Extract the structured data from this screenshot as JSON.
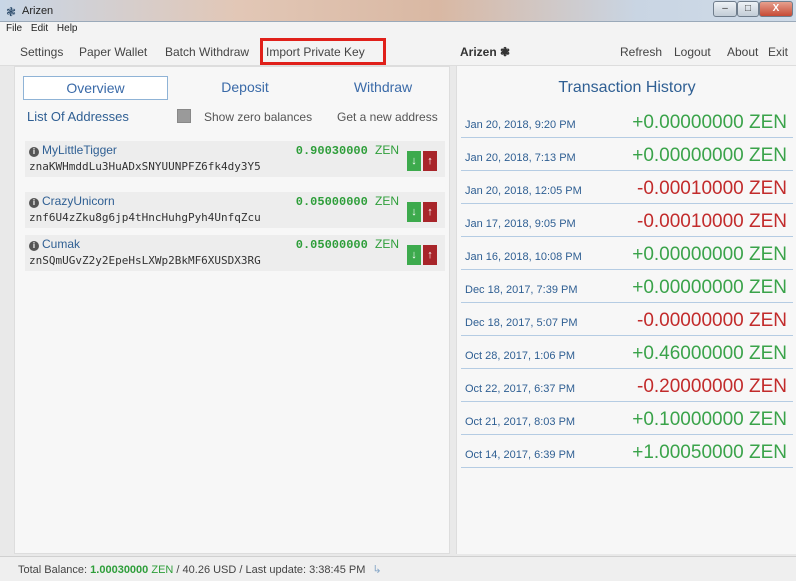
{
  "window": {
    "title": "Arizen",
    "icon": "arizen-logo-icon",
    "minimize": "–",
    "maximize": "□",
    "close": "X"
  },
  "menu": [
    "File",
    "Edit",
    "Help"
  ],
  "nav": {
    "settings": "Settings",
    "paper_wallet": "Paper Wallet",
    "batch_withdraw": "Batch Withdraw",
    "import_private_key": "Import Private Key",
    "brand": "Arizen ❃",
    "refresh": "Refresh",
    "logout": "Logout",
    "about": "About",
    "exit": "Exit"
  },
  "tabs": {
    "overview": "Overview",
    "deposit": "Deposit",
    "withdraw": "Withdraw"
  },
  "addresses_section": {
    "title": "List Of Addresses",
    "show_zero_label": "Show zero balances",
    "get_new_label": "Get a new address",
    "items": [
      {
        "name": "MyLittleTigger",
        "balance": "0.90030000",
        "unit": "ZEN",
        "address": "znaKWHmddLu3HuADxSNYUUNPFZ6fk4dy3Y5"
      },
      {
        "name": "CrazyUnicorn",
        "balance": "0.05000000",
        "unit": "ZEN",
        "address": "znf6U4zZku8g6jp4tHncHuhgPyh4UnfqZcu"
      },
      {
        "name": "Cumak",
        "balance": "0.05000000",
        "unit": "ZEN",
        "address": "znSQmUGvZ2y2EpeHsLXWp2BkMF6XUSDX3RG"
      }
    ]
  },
  "history": {
    "title": "Transaction History",
    "items": [
      {
        "date": "Jan 20, 2018, 9:20 PM",
        "amount": "+0.00000000 ZEN",
        "sign": "pos"
      },
      {
        "date": "Jan 20, 2018, 7:13 PM",
        "amount": "+0.00000000 ZEN",
        "sign": "pos"
      },
      {
        "date": "Jan 20, 2018, 12:05 PM",
        "amount": "-0.00010000 ZEN",
        "sign": "neg"
      },
      {
        "date": "Jan 17, 2018, 9:05 PM",
        "amount": "-0.00010000 ZEN",
        "sign": "neg"
      },
      {
        "date": "Jan 16, 2018, 10:08 PM",
        "amount": "+0.00000000 ZEN",
        "sign": "pos"
      },
      {
        "date": "Dec 18, 2017, 7:39 PM",
        "amount": "+0.00000000 ZEN",
        "sign": "pos"
      },
      {
        "date": "Dec 18, 2017, 5:07 PM",
        "amount": "-0.00000000 ZEN",
        "sign": "neg"
      },
      {
        "date": "Oct 28, 2017, 1:06 PM",
        "amount": "+0.46000000 ZEN",
        "sign": "pos"
      },
      {
        "date": "Oct 22, 2017, 6:37 PM",
        "amount": "-0.20000000 ZEN",
        "sign": "neg"
      },
      {
        "date": "Oct 21, 2017, 8:03 PM",
        "amount": "+0.10000000 ZEN",
        "sign": "pos"
      },
      {
        "date": "Oct 14, 2017, 6:39 PM",
        "amount": "+1.00050000 ZEN",
        "sign": "pos"
      }
    ]
  },
  "status": {
    "label": "Total Balance:",
    "amount": "1.00030000",
    "unit": "ZEN",
    "rest": "/ 40.26 USD / Last update: 3:38:45 PM",
    "icon": "↳"
  },
  "colors": {
    "positive": "#3aa34a",
    "negative": "#c22b2b",
    "accent": "#2f5f93",
    "highlight": "#e0201a"
  }
}
